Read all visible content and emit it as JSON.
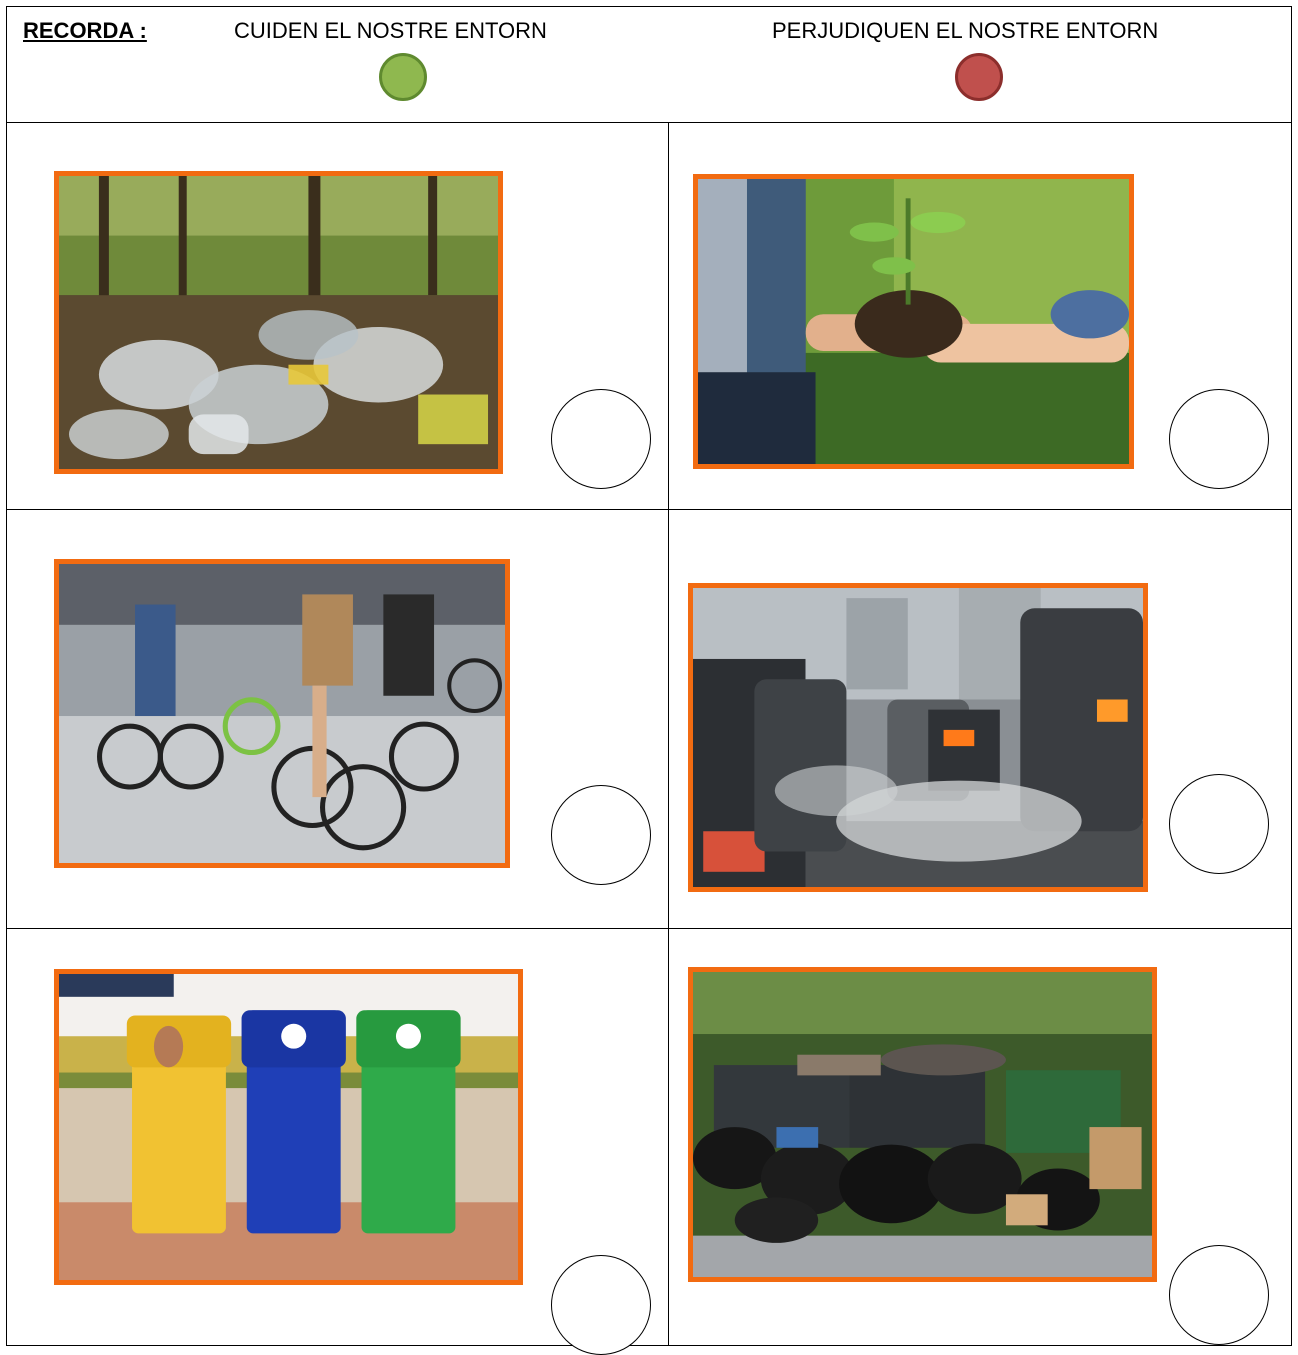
{
  "header": {
    "recorda": "RECORDA :",
    "good_label": "CUIDEN EL NOSTRE ENTORN",
    "bad_label": "PERJUDIQUEN EL NOSTRE ENTORN",
    "good_color": "#8fb84f",
    "bad_color": "#c0504d"
  },
  "cards": [
    {
      "picture": "plastic-waste-forest-photo"
    },
    {
      "picture": "planting-seedling-photo"
    },
    {
      "picture": "cyclists-photo"
    },
    {
      "picture": "car-exhaust-traffic-photo"
    },
    {
      "picture": "recycling-bins-photo"
    },
    {
      "picture": "garbage-bags-street-photo"
    }
  ],
  "accent": "#f26b11"
}
